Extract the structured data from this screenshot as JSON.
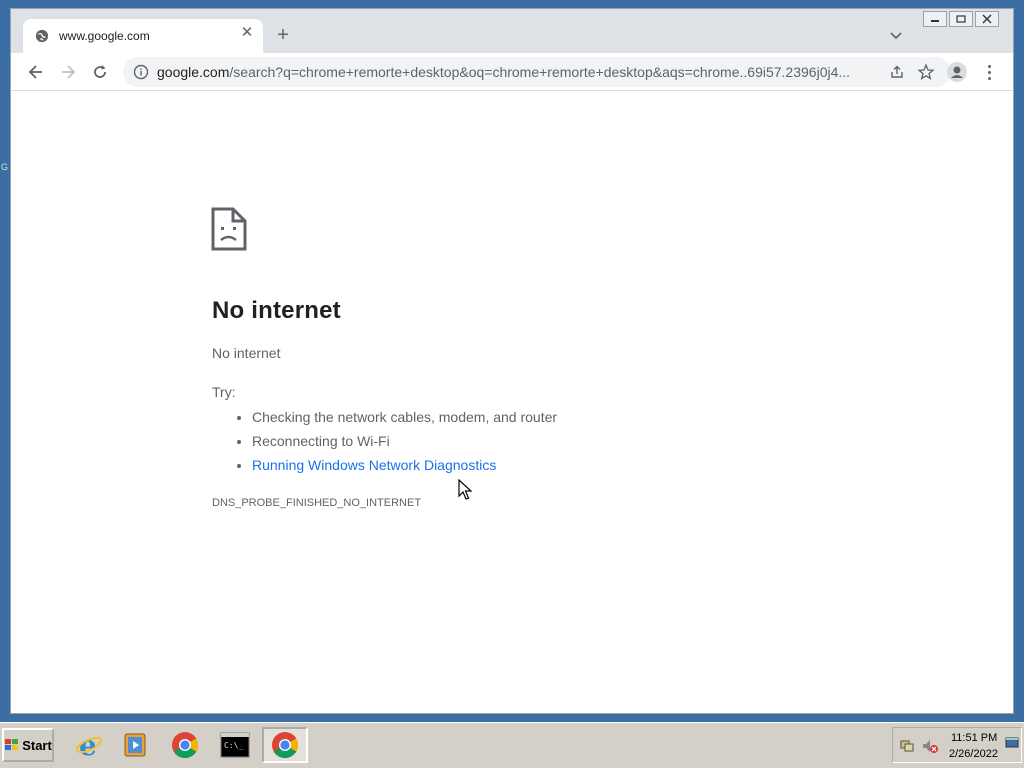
{
  "desktop": {
    "edge_text": "G"
  },
  "browser": {
    "tab": {
      "title": "www.google.com",
      "favicon": "globe-icon"
    },
    "new_tab": "+",
    "window_controls": [
      "minimize-icon",
      "restore-icon",
      "close-icon"
    ],
    "omnibox": {
      "host": "google.com",
      "path": "/search?q=chrome+remorte+desktop&oq=chrome+remorte+desktop&aqs=chrome..69i57.2396j0j4..."
    }
  },
  "error_page": {
    "title": "No internet",
    "subtitle": "No internet",
    "try_label": "Try:",
    "suggestions": [
      "Checking the network cables, modem, and router",
      "Reconnecting to Wi-Fi"
    ],
    "diagnostics_link": "Running Windows Network Diagnostics",
    "error_code": "DNS_PROBE_FINISHED_NO_INTERNET"
  },
  "taskbar": {
    "start_label": "Start",
    "apps": [
      "internet-explorer-icon",
      "media-player-icon",
      "chrome-icon",
      "command-prompt-icon",
      "chrome-icon"
    ],
    "clock": {
      "time": "11:51 PM",
      "date": "2/26/2022"
    }
  }
}
